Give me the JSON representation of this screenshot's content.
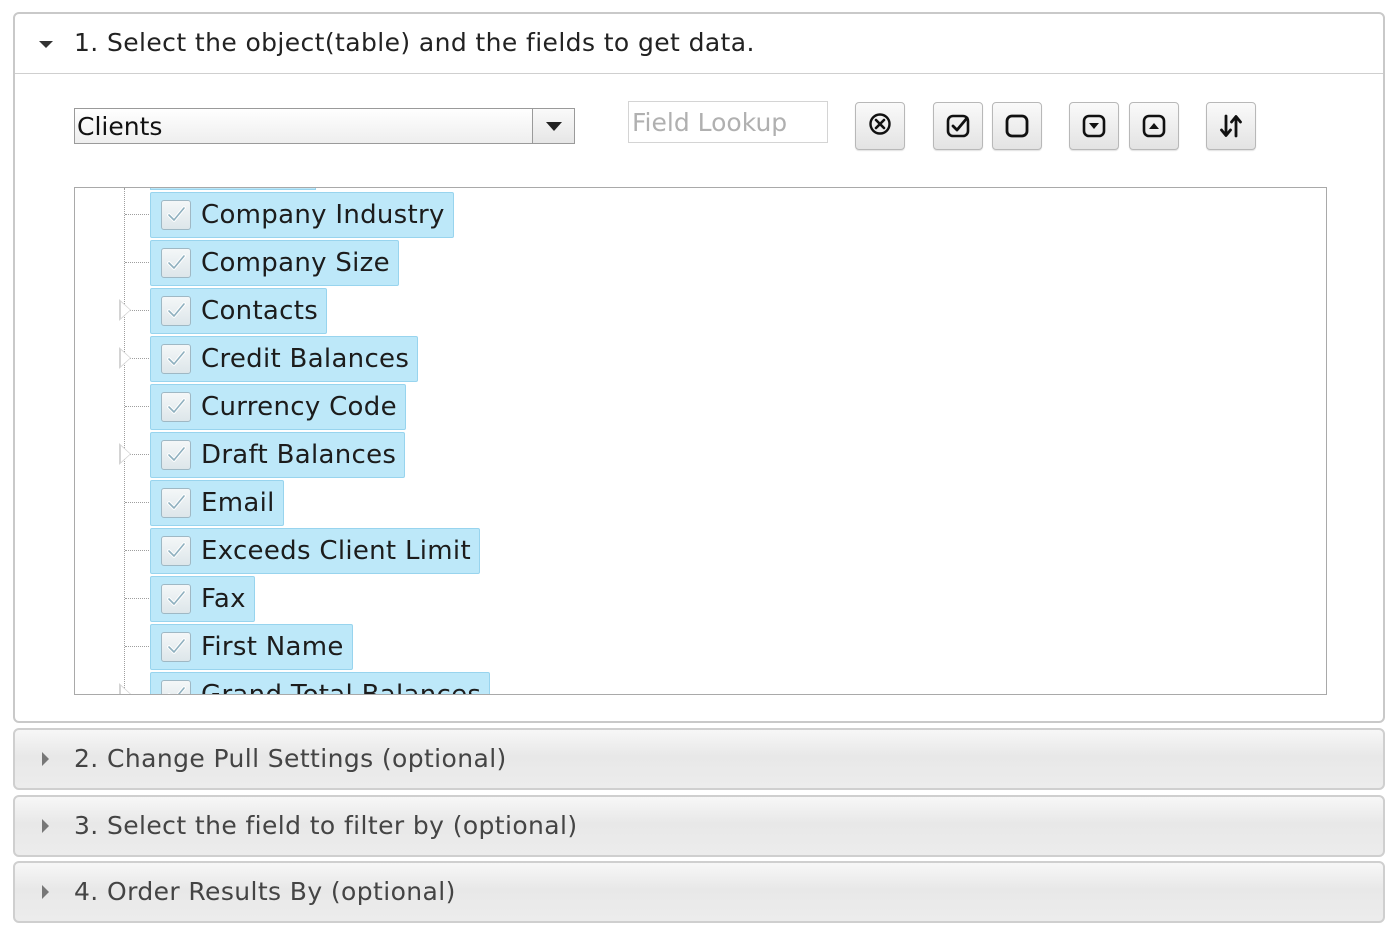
{
  "sections": {
    "s1_title": "1. Select the object(table) and the fields to get data.",
    "s2_title": "2. Change Pull Settings (optional)",
    "s3_title": "3. Select the field to filter by (optional)",
    "s4_title": "4. Order Results By (optional)"
  },
  "toolbar": {
    "object_value": "Clients",
    "lookup_placeholder": "Field Lookup",
    "clear_icon": "circle-x-icon",
    "check_all_icon": "check-square-icon",
    "uncheck_all_icon": "empty-square-icon",
    "expand_all_icon": "expand-down-icon",
    "collapse_all_icon": "collapse-up-icon",
    "sort_icon": "sort-arrows-icon"
  },
  "tree": {
    "items": [
      {
        "label": "Company Industry",
        "expandable": false,
        "checked": true
      },
      {
        "label": "Company Size",
        "expandable": false,
        "checked": true
      },
      {
        "label": "Contacts",
        "expandable": true,
        "checked": true
      },
      {
        "label": "Credit Balances",
        "expandable": true,
        "checked": true
      },
      {
        "label": "Currency Code",
        "expandable": false,
        "checked": true
      },
      {
        "label": "Draft Balances",
        "expandable": true,
        "checked": true
      },
      {
        "label": "Email",
        "expandable": false,
        "checked": true
      },
      {
        "label": "Exceeds Client Limit",
        "expandable": false,
        "checked": true
      },
      {
        "label": "Fax",
        "expandable": false,
        "checked": true
      },
      {
        "label": "First Name",
        "expandable": false,
        "checked": true
      },
      {
        "label": "Grand Total Balances",
        "expandable": true,
        "checked": true
      }
    ]
  },
  "colors": {
    "node_bg": "#bde8f9",
    "node_border": "#98d4ee"
  }
}
